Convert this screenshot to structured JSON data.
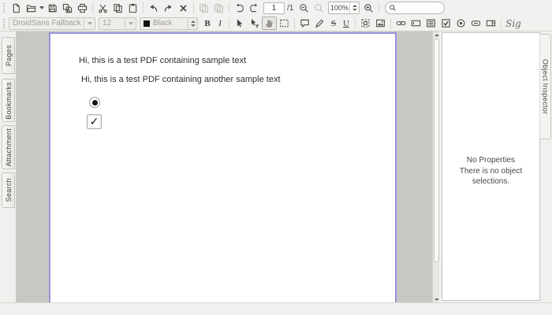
{
  "toolbar_main": {
    "page_number": "1",
    "page_total": "/1",
    "zoom_level": "100%",
    "search_value": "",
    "icons": [
      "new-document",
      "open",
      "open-dropdown",
      "save",
      "save-all",
      "print",
      "cut",
      "copy",
      "paste",
      "undo",
      "redo",
      "delete",
      "copy-page-disabled",
      "paste-page-disabled",
      "rotate-left",
      "rotate-right",
      "zoom-out",
      "zoom-original",
      "zoom-in",
      "search"
    ]
  },
  "toolbar_format": {
    "font_family": "DroidSans Fallback",
    "font_size": "12",
    "font_color": "Black",
    "bold": "B",
    "italic": "I",
    "strikeout": "S",
    "underline": "U",
    "signature": "Sig",
    "icons": [
      "select-tool",
      "text-select-tool",
      "hand-tool-selected",
      "marquee-zoom",
      "comment-bubble",
      "highlighter-pen",
      "snapshot",
      "image",
      "link",
      "text-field",
      "list-box",
      "checkbox-field",
      "radio-button-field",
      "push-button-field",
      "combo-box-field",
      "signature-field"
    ]
  },
  "sidebar": {
    "tabs": [
      {
        "label": "Pages"
      },
      {
        "label": "Bookmarks"
      },
      {
        "label": "Attachment"
      },
      {
        "label": "Search"
      }
    ]
  },
  "document": {
    "text_line_1": "Hi, this is a test PDF containing sample text",
    "text_line_2": "Hi, this is a test PDF containing another sample text",
    "radio_selected": true,
    "checkbox_checked": true,
    "checkbox_glyph": "✓"
  },
  "inspector": {
    "tab": "Object Inspector",
    "no_properties_title": "No Properties",
    "no_properties_message": "There is no object selections."
  },
  "colors": {
    "toolbar_background": "#f2f1ef",
    "document_background": "#c9c7c4",
    "page_border": "#9494de",
    "status_bar": "#f1f0ee"
  }
}
